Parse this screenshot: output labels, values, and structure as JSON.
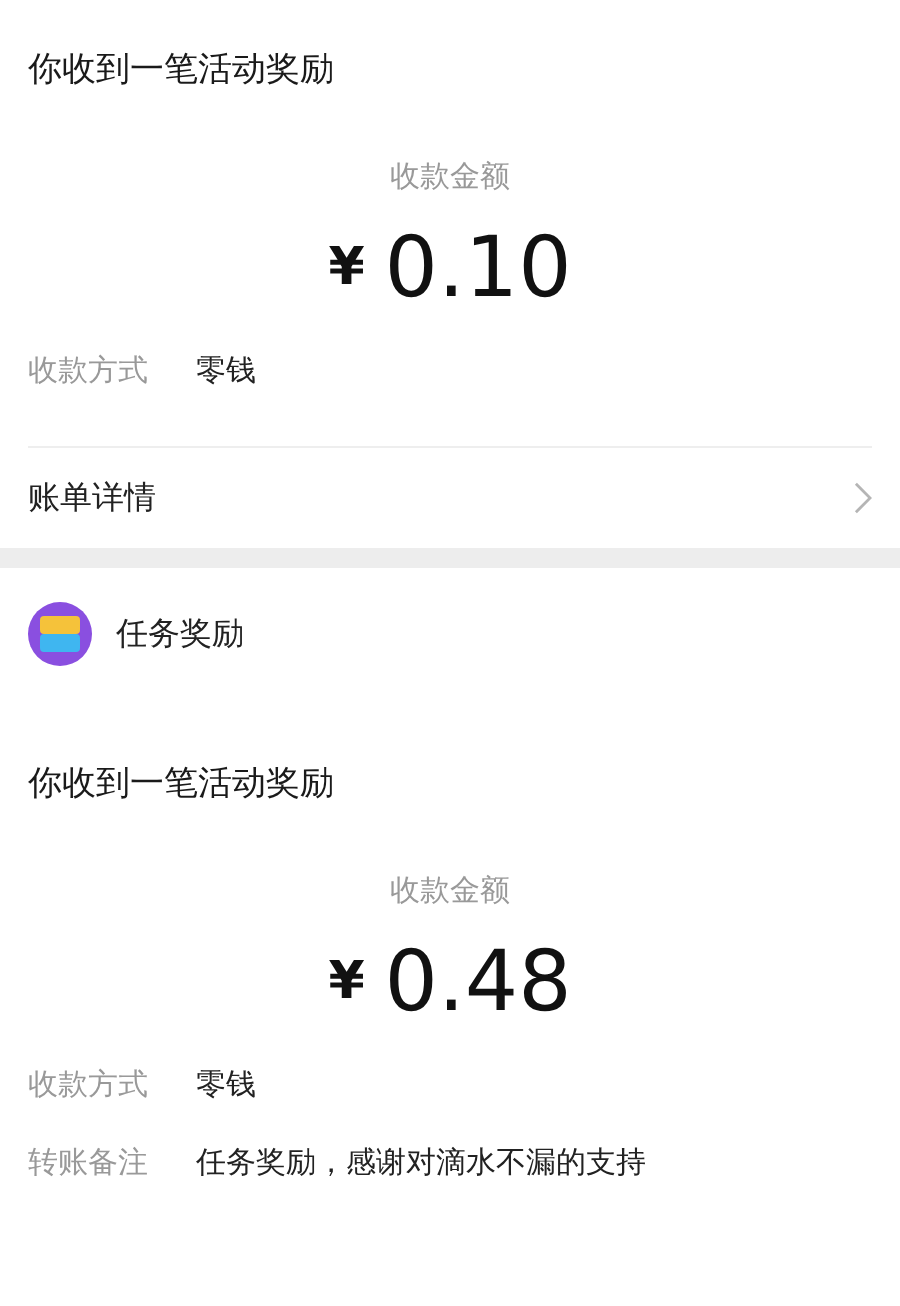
{
  "cards": [
    {
      "title": "你收到一笔活动奖励",
      "amount_label": "收款金额",
      "currency": "¥",
      "amount": "0.10",
      "fields": [
        {
          "label": "收款方式",
          "value": "零钱"
        }
      ],
      "link": {
        "label": "账单详情"
      }
    },
    {
      "source": {
        "name": "任务奖励"
      },
      "title": "你收到一笔活动奖励",
      "amount_label": "收款金额",
      "currency": "¥",
      "amount": "0.48",
      "fields": [
        {
          "label": "收款方式",
          "value": "零钱"
        },
        {
          "label": "转账备注",
          "value": "任务奖励，感谢对滴水不漏的支持"
        }
      ]
    }
  ]
}
